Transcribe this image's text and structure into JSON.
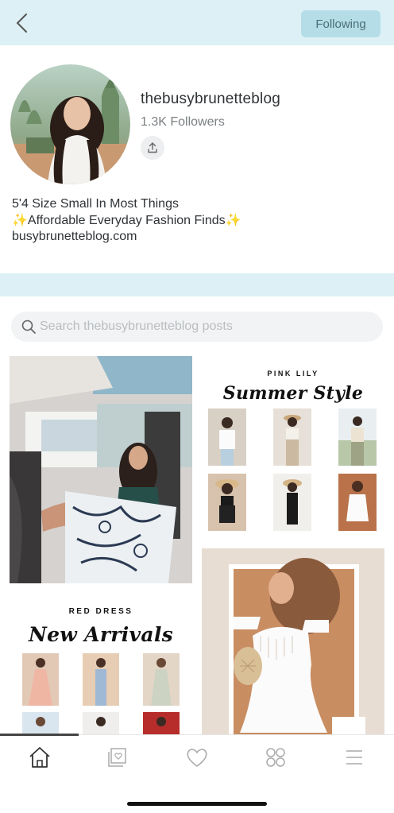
{
  "header": {
    "back_icon": "chevron-left-icon",
    "following_label": "Following"
  },
  "profile": {
    "username": "thebusybrunetteblog",
    "followers": "1.3K Followers",
    "share_icon": "share-upload-icon",
    "bio_lines": [
      "5'4 Size Small In Most Things",
      "✨Affordable Everyday Fashion Finds✨",
      "busybrunetteblog.com"
    ]
  },
  "search": {
    "placeholder": "Search thebusybrunetteblog posts",
    "value": ""
  },
  "posts": {
    "summer": {
      "brand": "PINK LILY",
      "title": "Summer Style"
    },
    "red": {
      "brand": "RED DRESS",
      "title": "New Arrivals"
    }
  },
  "tabs": [
    {
      "name": "home",
      "icon": "home-icon",
      "active": true
    },
    {
      "name": "posts",
      "icon": "photo-stack-icon"
    },
    {
      "name": "favorites",
      "icon": "heart-icon"
    },
    {
      "name": "collections",
      "icon": "grid-icon"
    },
    {
      "name": "menu",
      "icon": "menu-icon"
    }
  ],
  "colors": {
    "header_bg": "#dcf0f5",
    "button_bg": "#b5dde7",
    "button_text": "#4b6f78"
  }
}
